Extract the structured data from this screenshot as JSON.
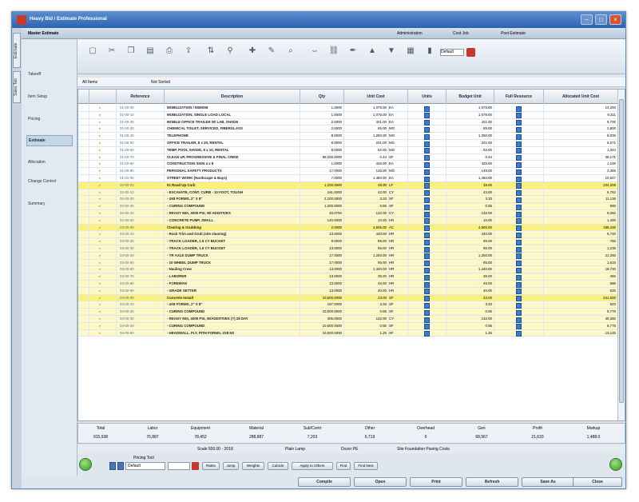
{
  "window": {
    "title": "Heavy Bid / Estimate Professional"
  },
  "inner_bar": {
    "title": "Master Estimate",
    "field1": "Administration",
    "field2": "Cost Job",
    "field3": "Post Estimate"
  },
  "side_tabs": [
    "Estimate",
    "Sales Tab"
  ],
  "nav": {
    "items": [
      {
        "label": "Takeoff"
      },
      {
        "label": "Item Setup"
      },
      {
        "label": "Pricing"
      },
      {
        "label": "Estimate"
      },
      {
        "label": "Allocation"
      },
      {
        "label": "Change Control"
      },
      {
        "label": "Summary"
      }
    ],
    "active_index": 3
  },
  "toolbar": {
    "icons": [
      "new-icon",
      "cut-icon",
      "copy-icon",
      "paste-icon",
      "print-icon",
      "export-icon",
      "sort-icon",
      "filter-icon",
      "add-icon",
      "edit-icon",
      "find-icon",
      "move-icon",
      "link-icon",
      "pen-icon",
      "up-icon",
      "down-icon",
      "calc-icon",
      "chart-icon"
    ],
    "select_value": "Default"
  },
  "filterbar": {
    "left": "All Items",
    "right": "Not Sorted"
  },
  "grid": {
    "columns": [
      "Reference",
      "Description",
      "Qty",
      "Unit Cost",
      "Units",
      "Budget Unit",
      "Full Resource",
      "Allocated Unit Cost"
    ],
    "rows": [
      {
        "ref": "01-00-00",
        "desc": "MOBILIZATION / DEMOB",
        "qty": "1.0000",
        "cost": "1,075.00",
        "unit": "EA",
        "budget": "1,076.00",
        "alloc": "14,200",
        "style": ""
      },
      {
        "ref": "01-00-10",
        "desc": "MOBILIZATION, SINGLE LOAD LOCAL",
        "qty": "1.0000",
        "cost": "1,075.00",
        "unit": "EA",
        "budget": "1,076.00",
        "alloc": "9,311",
        "style": ""
      },
      {
        "ref": "01-00-20",
        "desc": "MOBILE OFFICE TRAILER W/ LAB, SHADE",
        "qty": "2.0000",
        "cost": "421.00",
        "unit": "EA",
        "budget": "421.00",
        "alloc": "5,700",
        "style": ""
      },
      {
        "ref": "01-00-30",
        "desc": "CHEMICAL TOILET, SERVICED, FIBERGLASS",
        "qty": "2.0000",
        "cost": "85.00",
        "unit": "MO",
        "budget": "85.00",
        "alloc": "2,800",
        "style": ""
      },
      {
        "ref": "01-00-40",
        "desc": "TELEPHONE",
        "qty": "8.0000",
        "cost": "1,250.00",
        "unit": "MO",
        "budget": "1,250.00",
        "alloc": "8,000",
        "style": ""
      },
      {
        "ref": "01-00-50",
        "desc": "OFFICE TRAILER, 8 x 20, RENTAL",
        "qty": "8.0000",
        "cost": "221.00",
        "unit": "MO",
        "budget": "221.00",
        "alloc": "6,571",
        "style": ""
      },
      {
        "ref": "01-00-60",
        "desc": "TEMP. POOL SHADE, 8 x 10, RENTAL",
        "qty": "8.0000",
        "cost": "52.00",
        "unit": "MO",
        "budget": "52.00",
        "alloc": "1,344",
        "style": ""
      },
      {
        "ref": "01-00-70",
        "desc": "CLEAN UP, PROGRESSIVE & FINAL CREW",
        "qty": "86,000.0000",
        "cost": "0.44",
        "unit": "SF",
        "budget": "0.44",
        "alloc": "38,171",
        "style": ""
      },
      {
        "ref": "01-00-80",
        "desc": "CONSTRUCTION SIGN 4 x 8",
        "qty": "1.0000",
        "cost": "425.00",
        "unit": "EA",
        "budget": "425.00",
        "alloc": "1,100",
        "style": ""
      },
      {
        "ref": "01-00-90",
        "desc": "PERSONAL SAFETY PRODUCTS",
        "qty": "17.0000",
        "cost": "145.00",
        "unit": "MO",
        "budget": "145.00",
        "alloc": "2,465",
        "style": ""
      },
      {
        "ref": "01-01-00",
        "desc": "STREET WORK (Hardscape & Bays)",
        "qty": "7.0000",
        "cost": "1,450.00",
        "unit": "EA",
        "budget": "1,450.00",
        "alloc": "10,647",
        "style": ""
      },
      {
        "ref": "02-00-00",
        "desc": "01 Road Up Curb",
        "qty": "1,200.0000",
        "cost": "48.00",
        "unit": "LF",
        "budget": "48.00",
        "alloc": "104,209",
        "style": "group"
      },
      {
        "ref": "02-00-10",
        "desc": "- EXCAVATE, CONT. CURB - 10 FOOT, TOUGH",
        "qty": "161.0000",
        "cost": "42.00",
        "unit": "CY",
        "budget": "42.00",
        "alloc": "6,762",
        "style": "sub"
      },
      {
        "ref": "02-00-20",
        "desc": "- 4X8 FORMS, 2\" X 8\"",
        "qty": "2,200.0000",
        "cost": "3.33",
        "unit": "SF",
        "budget": "3.33",
        "alloc": "11,136",
        "style": "sub"
      },
      {
        "ref": "02-00-30",
        "desc": "- CURING COMPOUND",
        "qty": "1,200.0000",
        "cost": "0.55",
        "unit": "SF",
        "budget": "0.55",
        "alloc": "660",
        "style": "sub"
      },
      {
        "ref": "02-00-40",
        "desc": "- READY MIX, 3000 PSI, W/ ADDITIVES",
        "qty": "46.0750",
        "cost": "132.00",
        "unit": "CY",
        "budget": "132.00",
        "alloc": "6,082",
        "style": "sub"
      },
      {
        "ref": "02-00-50",
        "desc": "- CONCRETE PUMP, SMALL",
        "qty": "140.0000",
        "cost": "10.00",
        "unit": "HR",
        "budget": "10.00",
        "alloc": "1,400",
        "style": "sub"
      },
      {
        "ref": "03-00-00",
        "desc": "Clearing & Grubbing",
        "qty": "2.0000",
        "cost": "4,505.00",
        "unit": "AC",
        "budget": "4,505.00",
        "alloc": "198,430",
        "style": "group"
      },
      {
        "ref": "03-00-10",
        "desc": "- Rock Trim and Grub (site clearing)",
        "qty": "13.0000",
        "cost": "440.00",
        "unit": "HR",
        "budget": "440.00",
        "alloc": "5,720",
        "style": "sub"
      },
      {
        "ref": "03-00-20",
        "desc": "- TRACK LOADER, 1.5 CY BUCKET",
        "qty": "8.0000",
        "cost": "95.00",
        "unit": "HR",
        "budget": "95.00",
        "alloc": "760",
        "style": "sub"
      },
      {
        "ref": "03-00-30",
        "desc": "- TRACK LOADER, 1.5 CY BUCKET",
        "qty": "13.0000",
        "cost": "95.00",
        "unit": "HR",
        "budget": "95.00",
        "alloc": "1,235",
        "style": "sub"
      },
      {
        "ref": "03-00-40",
        "desc": "- TR AXLE DUMP TRUCK",
        "qty": "17.0000",
        "cost": "1,250.00",
        "unit": "HR",
        "budget": "1,250.00",
        "alloc": "21,250",
        "style": "sub"
      },
      {
        "ref": "03-00-50",
        "desc": "- 10 WHEEL DUMP TRUCK",
        "qty": "17.0000",
        "cost": "95.00",
        "unit": "HR",
        "budget": "95.00",
        "alloc": "1,615",
        "style": "sub"
      },
      {
        "ref": "03-00-60",
        "desc": "- Hauling Crew",
        "qty": "13.0000",
        "cost": "1,440.00",
        "unit": "HR",
        "budget": "1,440.00",
        "alloc": "18,720",
        "style": "sub"
      },
      {
        "ref": "03-00-70",
        "desc": "- LABORER",
        "qty": "13.0000",
        "cost": "35.00",
        "unit": "HR",
        "budget": "35.00",
        "alloc": "455",
        "style": "sub"
      },
      {
        "ref": "03-00-80",
        "desc": "- FOREMAN",
        "qty": "13.0000",
        "cost": "45.00",
        "unit": "HR",
        "budget": "45.00",
        "alloc": "585",
        "style": "sub"
      },
      {
        "ref": "03-00-90",
        "desc": "- GRADE SETTER",
        "qty": "13.0000",
        "cost": "40.00",
        "unit": "HR",
        "budget": "40.00",
        "alloc": "520",
        "style": "sub"
      },
      {
        "ref": "04-00-00",
        "desc": "Concrete Install",
        "qty": "10,500.0000",
        "cost": "23.00",
        "unit": "SF",
        "budget": "23.00",
        "alloc": "241,500",
        "style": "group"
      },
      {
        "ref": "04-00-10",
        "desc": "- 4X8 FORMS, 2\" X 8\"",
        "qty": "187.0000",
        "cost": "3.33",
        "unit": "SF",
        "budget": "3.33",
        "alloc": "623",
        "style": "sub"
      },
      {
        "ref": "04-00-20",
        "desc": "- CURING COMPOUND",
        "qty": "10,500.0000",
        "cost": "0.55",
        "unit": "SF",
        "budget": "0.55",
        "alloc": "5,775",
        "style": "sub"
      },
      {
        "ref": "04-00-30",
        "desc": "- READY MIX, 4000 PSI, W/ADDITIVES (?) 28 DAY",
        "qty": "306.0000",
        "cost": "132.00",
        "unit": "CY",
        "budget": "132.00",
        "alloc": "40,392",
        "style": "sub"
      },
      {
        "ref": "04-00-40",
        "desc": "- CURING COMPOUND",
        "qty": "10,500.0000",
        "cost": "0.55",
        "unit": "SF",
        "budget": "0.55",
        "alloc": "5,775",
        "style": "sub"
      },
      {
        "ref": "04-00-50",
        "desc": "- HEADWALL, FLY, PITH FORMS, 2X8 N3",
        "qty": "10,500.0000",
        "cost": "1.25",
        "unit": "SF",
        "budget": "1.25",
        "alloc": "13,125",
        "style": "sub"
      }
    ]
  },
  "totals": {
    "labels": [
      "Total",
      "Labor",
      "Equipment",
      "Material",
      "Sub/Contr",
      "Other",
      "Overhead",
      "Gen",
      "Profit",
      "Markup"
    ],
    "values": [
      "915,938",
      "76,887",
      "78,452",
      "288,887",
      "7,203",
      "6,719",
      "0",
      "68,967",
      "21,633",
      "1,488.0"
    ]
  },
  "status": {
    "left": "Scale 500.00 - 2018",
    "mid1": "Plain Lamp",
    "mid2": "Dozer PE",
    "right": "Site Foundation Paving Costs"
  },
  "bottom": {
    "label": "Pricing Tool",
    "select": "Default",
    "buttons": [
      "Rates",
      "Jump",
      "Weights",
      "Cubicle",
      "Apply to Others",
      "Find",
      "Find Next"
    ]
  },
  "footer": {
    "buttons": [
      "Compile",
      "Open",
      "Print",
      "Refresh",
      "Save As",
      "Close"
    ]
  }
}
